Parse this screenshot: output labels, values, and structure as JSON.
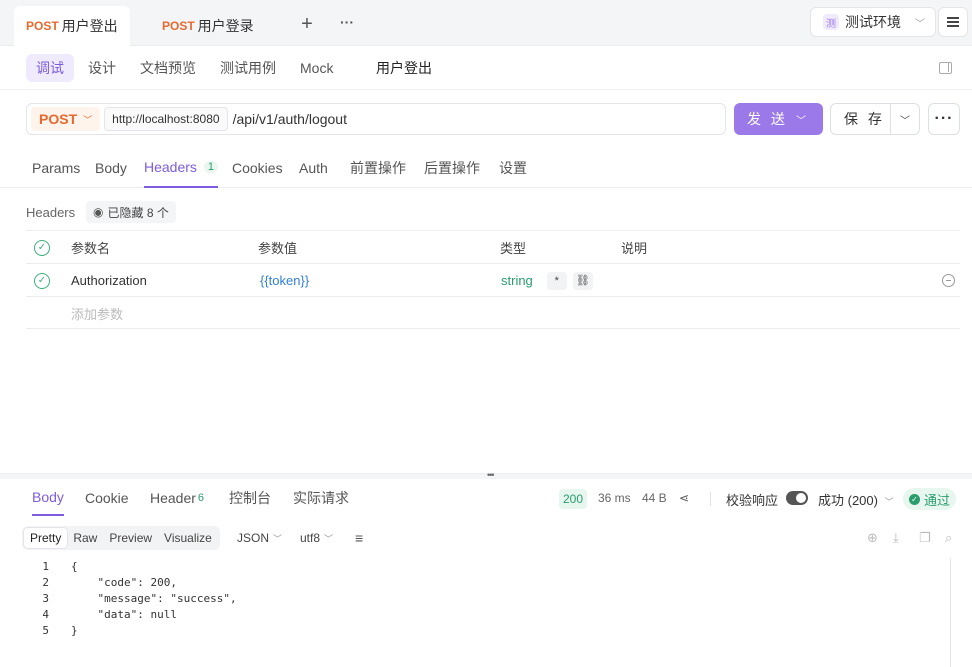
{
  "tabs": [
    {
      "method": "POST",
      "label": "用户登出"
    },
    {
      "method": "POST",
      "label": "用户登录"
    }
  ],
  "tab_add": "+",
  "tab_more": "···",
  "env": {
    "icon_text": "测",
    "label": "测试环境"
  },
  "subnav": {
    "items": [
      "调试",
      "设计",
      "文档预览",
      "测试用例",
      "Mock"
    ],
    "title": "用户登出"
  },
  "request": {
    "method": "POST",
    "base_url": "http://localhost:8080",
    "path": "/api/v1/auth/logout",
    "send_label": "发 送",
    "save_label": "保 存",
    "more": "···"
  },
  "req_tabs": [
    "Params",
    "Body",
    "Headers",
    "Cookies",
    "Auth",
    "前置操作",
    "后置操作",
    "设置"
  ],
  "headers_count": "1",
  "headers_section": {
    "title": "Headers",
    "hidden_label": "已隐藏 8 个"
  },
  "columns": [
    "参数名",
    "参数值",
    "类型",
    "说明"
  ],
  "rows": [
    {
      "name": "Authorization",
      "value": "{{token}}",
      "type": "string",
      "required_mark": "*"
    }
  ],
  "add_param_placeholder": "添加参数",
  "resp_tabs": [
    "Body",
    "Cookie",
    "Header",
    "控制台",
    "实际请求"
  ],
  "resp_header_count": "6",
  "response": {
    "status": "200",
    "time": "36 ms",
    "size": "44 B",
    "validate_label": "校验响应",
    "validate_on": true,
    "success_select": "成功 (200)",
    "pass_label": "通过"
  },
  "format_tabs": [
    "Pretty",
    "Raw",
    "Preview",
    "Visualize"
  ],
  "format_select": "JSON",
  "encoding_select": "utf8",
  "code_lines": [
    {
      "n": "1",
      "text": "{"
    },
    {
      "n": "2",
      "text": "    \"code\": 200,"
    },
    {
      "n": "3",
      "text": "    \"message\": \"success\","
    },
    {
      "n": "4",
      "text": "    \"data\": null"
    },
    {
      "n": "5",
      "text": "}"
    }
  ],
  "colors": {
    "accent": "#9b79e8",
    "method": "#e8692e",
    "success": "#2a9d6f",
    "link": "#2f7fd9"
  }
}
